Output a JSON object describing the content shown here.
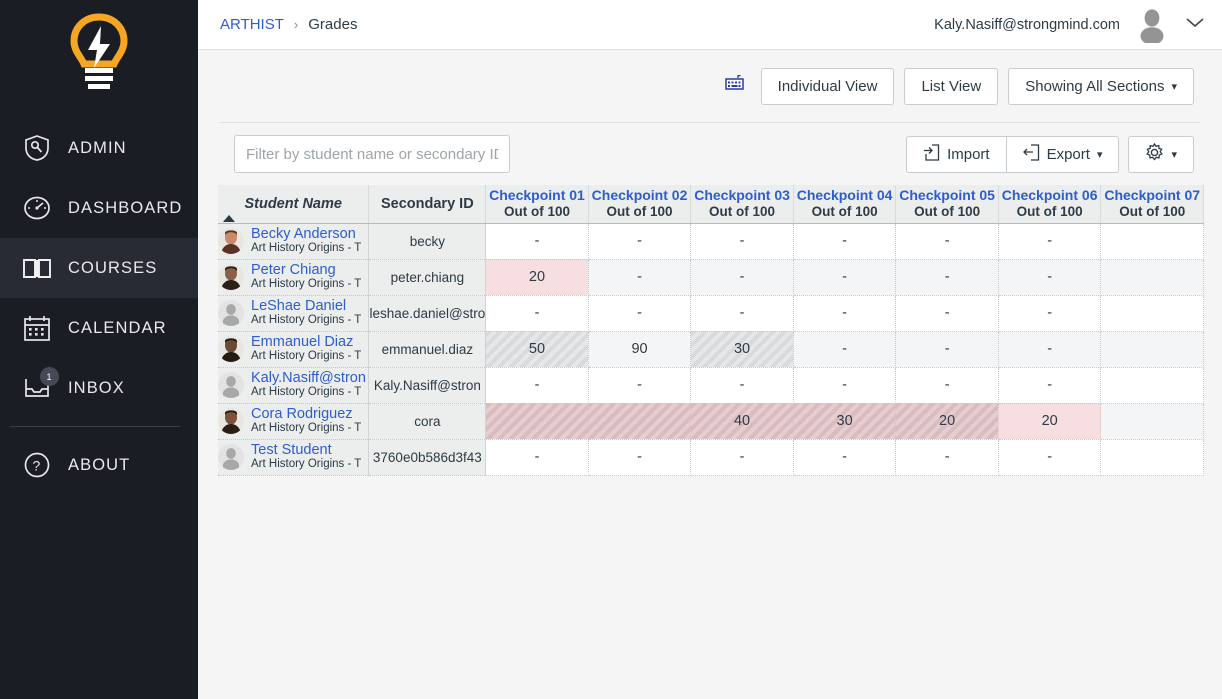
{
  "sidebar": {
    "logo": "lightbulb-logo",
    "items": [
      {
        "label": "ADMIN",
        "icon": "shield-admin-icon",
        "active": false,
        "badge": ""
      },
      {
        "label": "DASHBOARD",
        "icon": "gauge-icon",
        "active": false,
        "badge": ""
      },
      {
        "label": "COURSES",
        "icon": "book-icon",
        "active": true,
        "badge": ""
      },
      {
        "label": "CALENDAR",
        "icon": "calendar-icon",
        "active": false,
        "badge": ""
      },
      {
        "label": "INBOX",
        "icon": "inbox-icon",
        "active": false,
        "badge": "1"
      },
      {
        "label": "ABOUT",
        "icon": "question-circle-icon",
        "active": false,
        "badge": ""
      }
    ],
    "collapse_icon": "chevron-left-icon"
  },
  "header": {
    "breadcrumb_root": "ARTHIST",
    "breadcrumb_sep": "›",
    "breadcrumb_current": "Grades",
    "user_email": "Kaly.Nasiff@strongmind.com",
    "avatar_icon": "user-avatar-icon",
    "caret_icon": "chevron-down-icon"
  },
  "toolbar": {
    "keyboard_icon": "keyboard-shortcuts-icon",
    "individual_view": "Individual View",
    "list_view": "List View",
    "sections_filter": "Showing All Sections",
    "sections_caret": "▾"
  },
  "filterbar": {
    "placeholder": "Filter by student name or secondary ID",
    "value": "",
    "import_label": "Import",
    "import_icon": "import-icon",
    "export_label": "Export",
    "export_icon": "export-icon",
    "export_caret": "▾",
    "settings_icon": "gear-icon",
    "settings_caret": "▾"
  },
  "grid": {
    "col_student_name": "Student Name",
    "col_secondary_id": "Secondary ID",
    "sort_direction": "ascending",
    "checkpoint_columns": [
      {
        "title": "Checkpoint 01",
        "subtitle": "Out of 100"
      },
      {
        "title": "Checkpoint 02",
        "subtitle": "Out of 100"
      },
      {
        "title": "Checkpoint 03",
        "subtitle": "Out of 100"
      },
      {
        "title": "Checkpoint 04",
        "subtitle": "Out of 100"
      },
      {
        "title": "Checkpoint 05",
        "subtitle": "Out of 100"
      },
      {
        "title": "Checkpoint 06",
        "subtitle": "Out of 100"
      },
      {
        "title": "Checkpoint 07",
        "subtitle": "Out of 100"
      }
    ],
    "rows": [
      {
        "name": "Becky Anderson",
        "section": "Art History Origins - T",
        "secondary_id": "becky",
        "avatar": "photo",
        "grades": [
          {
            "value": "-",
            "style": "plain"
          },
          {
            "value": "-",
            "style": "plain"
          },
          {
            "value": "-",
            "style": "plain"
          },
          {
            "value": "-",
            "style": "plain"
          },
          {
            "value": "-",
            "style": "plain"
          },
          {
            "value": "-",
            "style": "plain"
          },
          {
            "value": "",
            "style": "plain"
          }
        ]
      },
      {
        "name": "Peter Chiang",
        "section": "Art History Origins - T",
        "secondary_id": "peter.chiang",
        "avatar": "photo",
        "grades": [
          {
            "value": "20",
            "style": "pink"
          },
          {
            "value": "-",
            "style": "plain"
          },
          {
            "value": "-",
            "style": "plain"
          },
          {
            "value": "-",
            "style": "plain"
          },
          {
            "value": "-",
            "style": "plain"
          },
          {
            "value": "-",
            "style": "plain"
          },
          {
            "value": "",
            "style": "plain"
          }
        ]
      },
      {
        "name": "LeShae Daniel",
        "section": "Art History Origins - T",
        "secondary_id": "leshae.daniel@stro",
        "avatar": "default",
        "grades": [
          {
            "value": "-",
            "style": "plain"
          },
          {
            "value": "-",
            "style": "plain"
          },
          {
            "value": "-",
            "style": "plain"
          },
          {
            "value": "-",
            "style": "plain"
          },
          {
            "value": "-",
            "style": "plain"
          },
          {
            "value": "-",
            "style": "plain"
          },
          {
            "value": "",
            "style": "plain"
          }
        ]
      },
      {
        "name": "Emmanuel Diaz",
        "section": "Art History Origins - T",
        "secondary_id": "emmanuel.diaz",
        "avatar": "photo",
        "grades": [
          {
            "value": "50",
            "style": "hatch-gray"
          },
          {
            "value": "90",
            "style": "plain"
          },
          {
            "value": "30",
            "style": "hatch-gray"
          },
          {
            "value": "-",
            "style": "plain"
          },
          {
            "value": "-",
            "style": "plain"
          },
          {
            "value": "-",
            "style": "plain"
          },
          {
            "value": "",
            "style": "plain"
          }
        ]
      },
      {
        "name": "Kaly.Nasiff@stron",
        "section": "Art History Origins - T",
        "secondary_id": "Kaly.Nasiff@stron",
        "avatar": "default",
        "grades": [
          {
            "value": "-",
            "style": "plain"
          },
          {
            "value": "-",
            "style": "plain"
          },
          {
            "value": "-",
            "style": "plain"
          },
          {
            "value": "-",
            "style": "plain"
          },
          {
            "value": "-",
            "style": "plain"
          },
          {
            "value": "-",
            "style": "plain"
          },
          {
            "value": "",
            "style": "plain"
          }
        ]
      },
      {
        "name": "Cora Rodriguez",
        "section": "Art History Origins - T",
        "secondary_id": "cora",
        "avatar": "photo",
        "grades": [
          {
            "value": "",
            "style": "hatch-pink"
          },
          {
            "value": "",
            "style": "hatch-pink"
          },
          {
            "value": "40",
            "style": "hatch-pink"
          },
          {
            "value": "30",
            "style": "hatch-pink"
          },
          {
            "value": "20",
            "style": "hatch-pink"
          },
          {
            "value": "20",
            "style": "pink"
          },
          {
            "value": "",
            "style": "plain"
          }
        ]
      },
      {
        "name": "Test Student",
        "section": "Art History Origins - T",
        "secondary_id": "3760e0b586d3f43",
        "avatar": "default",
        "grades": [
          {
            "value": "-",
            "style": "plain"
          },
          {
            "value": "-",
            "style": "plain"
          },
          {
            "value": "-",
            "style": "plain"
          },
          {
            "value": "-",
            "style": "plain"
          },
          {
            "value": "-",
            "style": "plain"
          },
          {
            "value": "-",
            "style": "plain"
          },
          {
            "value": "",
            "style": "plain"
          }
        ]
      }
    ]
  },
  "annotation": {
    "type": "left-pointing-arrow",
    "color": "#b30029",
    "points_at_row": "Cora Rodriguez"
  },
  "colors": {
    "sidebar_bg": "#1b1d25",
    "sidebar_active": "#282b34",
    "logo_accent": "#f5a623",
    "link_blue": "#2c5dd1",
    "text_dark": "#2d3b45",
    "grid_header_bg": "#eceded",
    "pink_cell": "#f7dfe1",
    "annotation_red": "#b30029"
  }
}
